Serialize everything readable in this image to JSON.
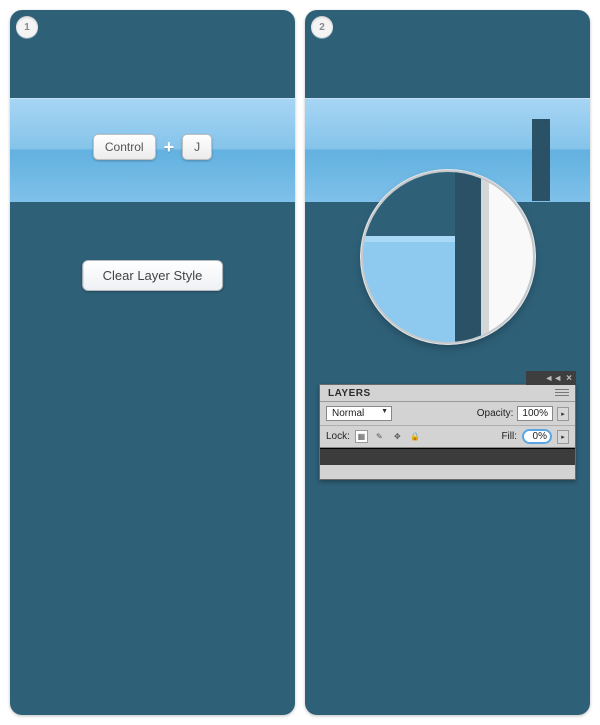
{
  "panel1": {
    "step": "1",
    "key_control": "Control",
    "plus": "+",
    "key_j": "J",
    "action": "Clear Layer Style"
  },
  "panel2": {
    "step": "2",
    "layers": {
      "title": "LAYERS",
      "blend_mode": "Normal",
      "opacity_label": "Opacity:",
      "opacity_value": "100%",
      "lock_label": "Lock:",
      "fill_label": "Fill:",
      "fill_value": "0%"
    }
  }
}
